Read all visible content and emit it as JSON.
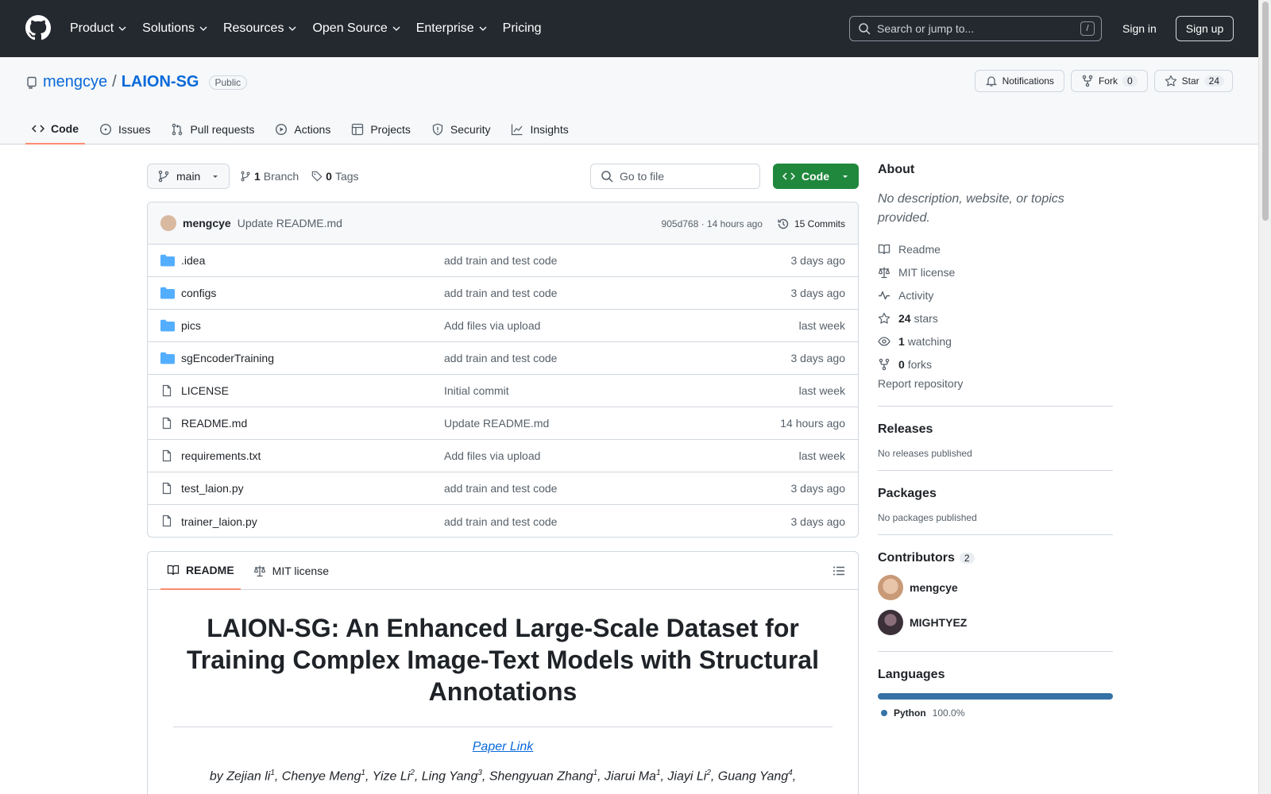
{
  "header": {
    "nav": [
      "Product",
      "Solutions",
      "Resources",
      "Open Source",
      "Enterprise",
      "Pricing"
    ],
    "search_placeholder": "Search or jump to...",
    "search_shortcut": "/",
    "sign_in": "Sign in",
    "sign_up": "Sign up"
  },
  "repo": {
    "owner": "mengcye",
    "separator": "/",
    "name": "LAION-SG",
    "visibility": "Public",
    "notifications_label": "Notifications",
    "fork_label": "Fork",
    "fork_count": "0",
    "star_label": "Star",
    "star_count": "24",
    "tabs": [
      "Code",
      "Issues",
      "Pull requests",
      "Actions",
      "Projects",
      "Security",
      "Insights"
    ]
  },
  "toolbar": {
    "branch": "main",
    "branch_count": "1",
    "branch_label": "Branch",
    "tag_count": "0",
    "tag_label": "Tags",
    "goto_placeholder": "Go to file",
    "code_button": "Code"
  },
  "commit": {
    "author": "mengcye",
    "message": "Update README.md",
    "hash_time": "905d768 · 14 hours ago",
    "commits_label": "15 Commits"
  },
  "files": [
    {
      "name": ".idea",
      "type": "dir",
      "message": "add train and test code",
      "date": "3 days ago"
    },
    {
      "name": "configs",
      "type": "dir",
      "message": "add train and test code",
      "date": "3 days ago"
    },
    {
      "name": "pics",
      "type": "dir",
      "message": "Add files via upload",
      "date": "last week"
    },
    {
      "name": "sgEncoderTraining",
      "type": "dir",
      "message": "add train and test code",
      "date": "3 days ago"
    },
    {
      "name": "LICENSE",
      "type": "file",
      "message": "Initial commit",
      "date": "last week"
    },
    {
      "name": "README.md",
      "type": "file",
      "message": "Update README.md",
      "date": "14 hours ago"
    },
    {
      "name": "requirements.txt",
      "type": "file",
      "message": "Add files via upload",
      "date": "last week"
    },
    {
      "name": "test_laion.py",
      "type": "file",
      "message": "add train and test code",
      "date": "3 days ago"
    },
    {
      "name": "trainer_laion.py",
      "type": "file",
      "message": "add train and test code",
      "date": "3 days ago"
    }
  ],
  "readme": {
    "tab_readme": "README",
    "tab_license": "MIT license",
    "title": "LAION-SG: An Enhanced Large-Scale Dataset for Training Complex Image-Text Models with Structural Annotations",
    "paper_link": "Paper Link",
    "authors_prefix": "by",
    "authors": [
      {
        "name": "Zejian li",
        "sup": "1"
      },
      {
        "name": "Chenye Meng",
        "sup": "1"
      },
      {
        "name": "Yize Li",
        "sup": "2"
      },
      {
        "name": "Ling Yang",
        "sup": "3"
      },
      {
        "name": "Shengyuan Zhang",
        "sup": "1"
      },
      {
        "name": "Jiarui Ma",
        "sup": "1"
      },
      {
        "name": "Jiayi Li",
        "sup": "2"
      },
      {
        "name": "Guang Yang",
        "sup": "4"
      }
    ]
  },
  "sidebar": {
    "about_title": "About",
    "about_desc": "No description, website, or topics provided.",
    "links": {
      "readme": "Readme",
      "license": "MIT license",
      "activity": "Activity",
      "stars_count": "24",
      "stars_label": "stars",
      "watching_count": "1",
      "watching_label": "watching",
      "forks_count": "0",
      "forks_label": "forks"
    },
    "report": "Report repository",
    "releases_title": "Releases",
    "releases_text": "No releases published",
    "packages_title": "Packages",
    "packages_text": "No packages published",
    "contributors_title": "Contributors",
    "contributors_count": "2",
    "contributors": [
      "mengcye",
      "MIGHTYEZ"
    ],
    "languages_title": "Languages",
    "languages": [
      {
        "name": "Python",
        "percent": "100.0%",
        "color": "#3572a5"
      }
    ]
  },
  "colors": {
    "header_bg": "#24292f",
    "link": "#0969da",
    "code_button": "#1f883d",
    "tab_underline": "#fd8c73",
    "folder": "#54aeff"
  }
}
